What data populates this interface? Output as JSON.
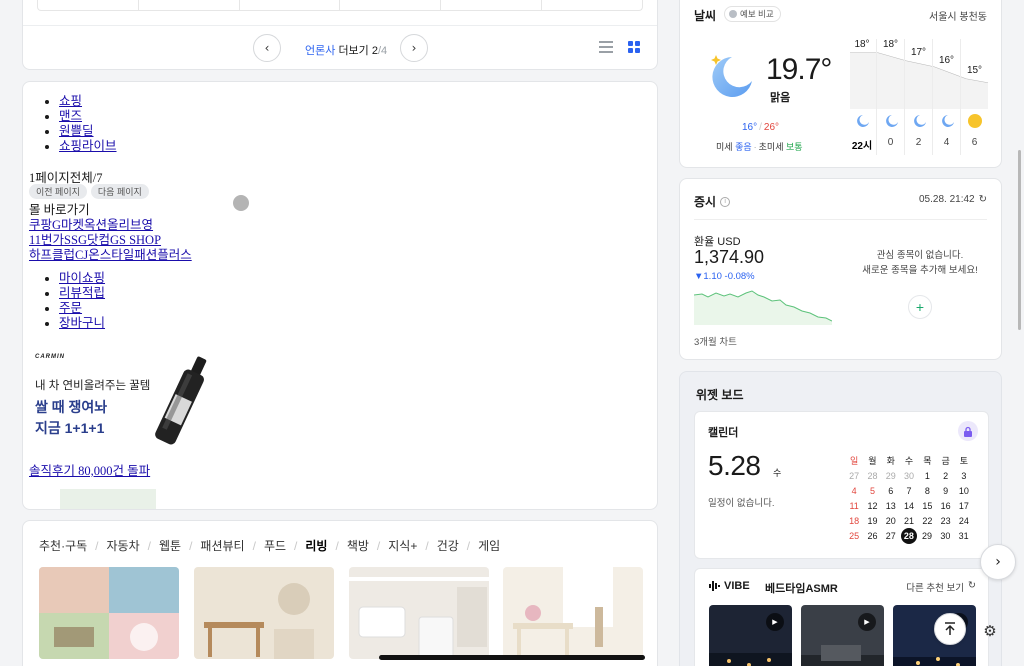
{
  "news_pager": {
    "label_publisher": "언론사",
    "label_more": "더보기",
    "page_current": "2",
    "page_total": "/4"
  },
  "shopping": {
    "menu_main": [
      "쇼핑",
      "맨즈",
      "원쁠딜",
      "쇼핑라이브"
    ],
    "page_indicator": "1페이지전체/7",
    "prev_page": "이전 페이지",
    "next_page": "다음 페이지",
    "mall_title": "몰 바로가기",
    "mall_line1": "쿠팡G마켓옥션올리브영",
    "mall_line2": "11번가SSG닷컴GS SHOP",
    "mall_line3": "하프클럽CJ온스타일패션플러스",
    "menu_my": [
      "마이쇼핑",
      "리뷰적립",
      "주문",
      "장바구니"
    ],
    "ad": {
      "brand": "CARMIN",
      "line1": "내 차 연비올려주는 꿀템",
      "line2": "쌀 때 쟁여놔",
      "line3": "지금 1+1+1"
    },
    "review_link": "솔직후기 80,000건 돌파"
  },
  "categories": {
    "tabs": [
      "추천·구독",
      "자동차",
      "웹툰",
      "패션뷰티",
      "푸드",
      "리빙",
      "책방",
      "지식+",
      "건강",
      "게임"
    ],
    "active": "리빙"
  },
  "weather": {
    "title": "날씨",
    "compare": "예보 비교",
    "location": "서울시 봉천동",
    "temp": "19.7°",
    "condition": "맑음",
    "low": "16°",
    "high": "26°",
    "dust_label": "미세",
    "dust_value": "좋음",
    "fine_dust_label": "초미세",
    "fine_dust_value": "보통",
    "hourly": [
      {
        "temp": "18°",
        "hour": "22시",
        "icon": "moon-icon"
      },
      {
        "temp": "18°",
        "hour": "0",
        "icon": "moon-icon"
      },
      {
        "temp": "17°",
        "hour": "2",
        "icon": "moon-icon"
      },
      {
        "temp": "16°",
        "hour": "4",
        "icon": "moon-icon"
      },
      {
        "temp": "15°",
        "hour": "6",
        "icon": "sun-icon"
      }
    ]
  },
  "stock": {
    "title": "증시",
    "time": "05.28. 21:42",
    "fx_label": "환율 USD",
    "fx_value": "1,374.90",
    "fx_change": "▼1.10  -0.08%",
    "period": "3개월 차트",
    "watch_empty_1": "관심 종목이 없습니다.",
    "watch_empty_2": "새로운 종목을 추가해 보세요!"
  },
  "widget_board": {
    "title": "위젯 보드",
    "calendar": {
      "title": "캘린더",
      "date": "5.28",
      "dow": "수",
      "empty": "일정이 없습니다.",
      "weekdays": [
        "일",
        "월",
        "화",
        "수",
        "목",
        "금",
        "토"
      ],
      "weeks": [
        [
          "27",
          "28",
          "29",
          "30",
          "1",
          "2",
          "3"
        ],
        [
          "4",
          "5",
          "6",
          "7",
          "8",
          "9",
          "10"
        ],
        [
          "11",
          "12",
          "13",
          "14",
          "15",
          "16",
          "17"
        ],
        [
          "18",
          "19",
          "20",
          "21",
          "22",
          "23",
          "24"
        ],
        [
          "25",
          "26",
          "27",
          "28",
          "29",
          "30",
          "31"
        ]
      ],
      "today": "28"
    },
    "music": {
      "logo": "VIBE",
      "title": "베드타임ASMR",
      "more": "다른 추천 보기"
    }
  },
  "colors": {
    "accent_blue": "#2b62f0",
    "sunday_red": "#e2463d",
    "good_green": "#1ea64b"
  }
}
